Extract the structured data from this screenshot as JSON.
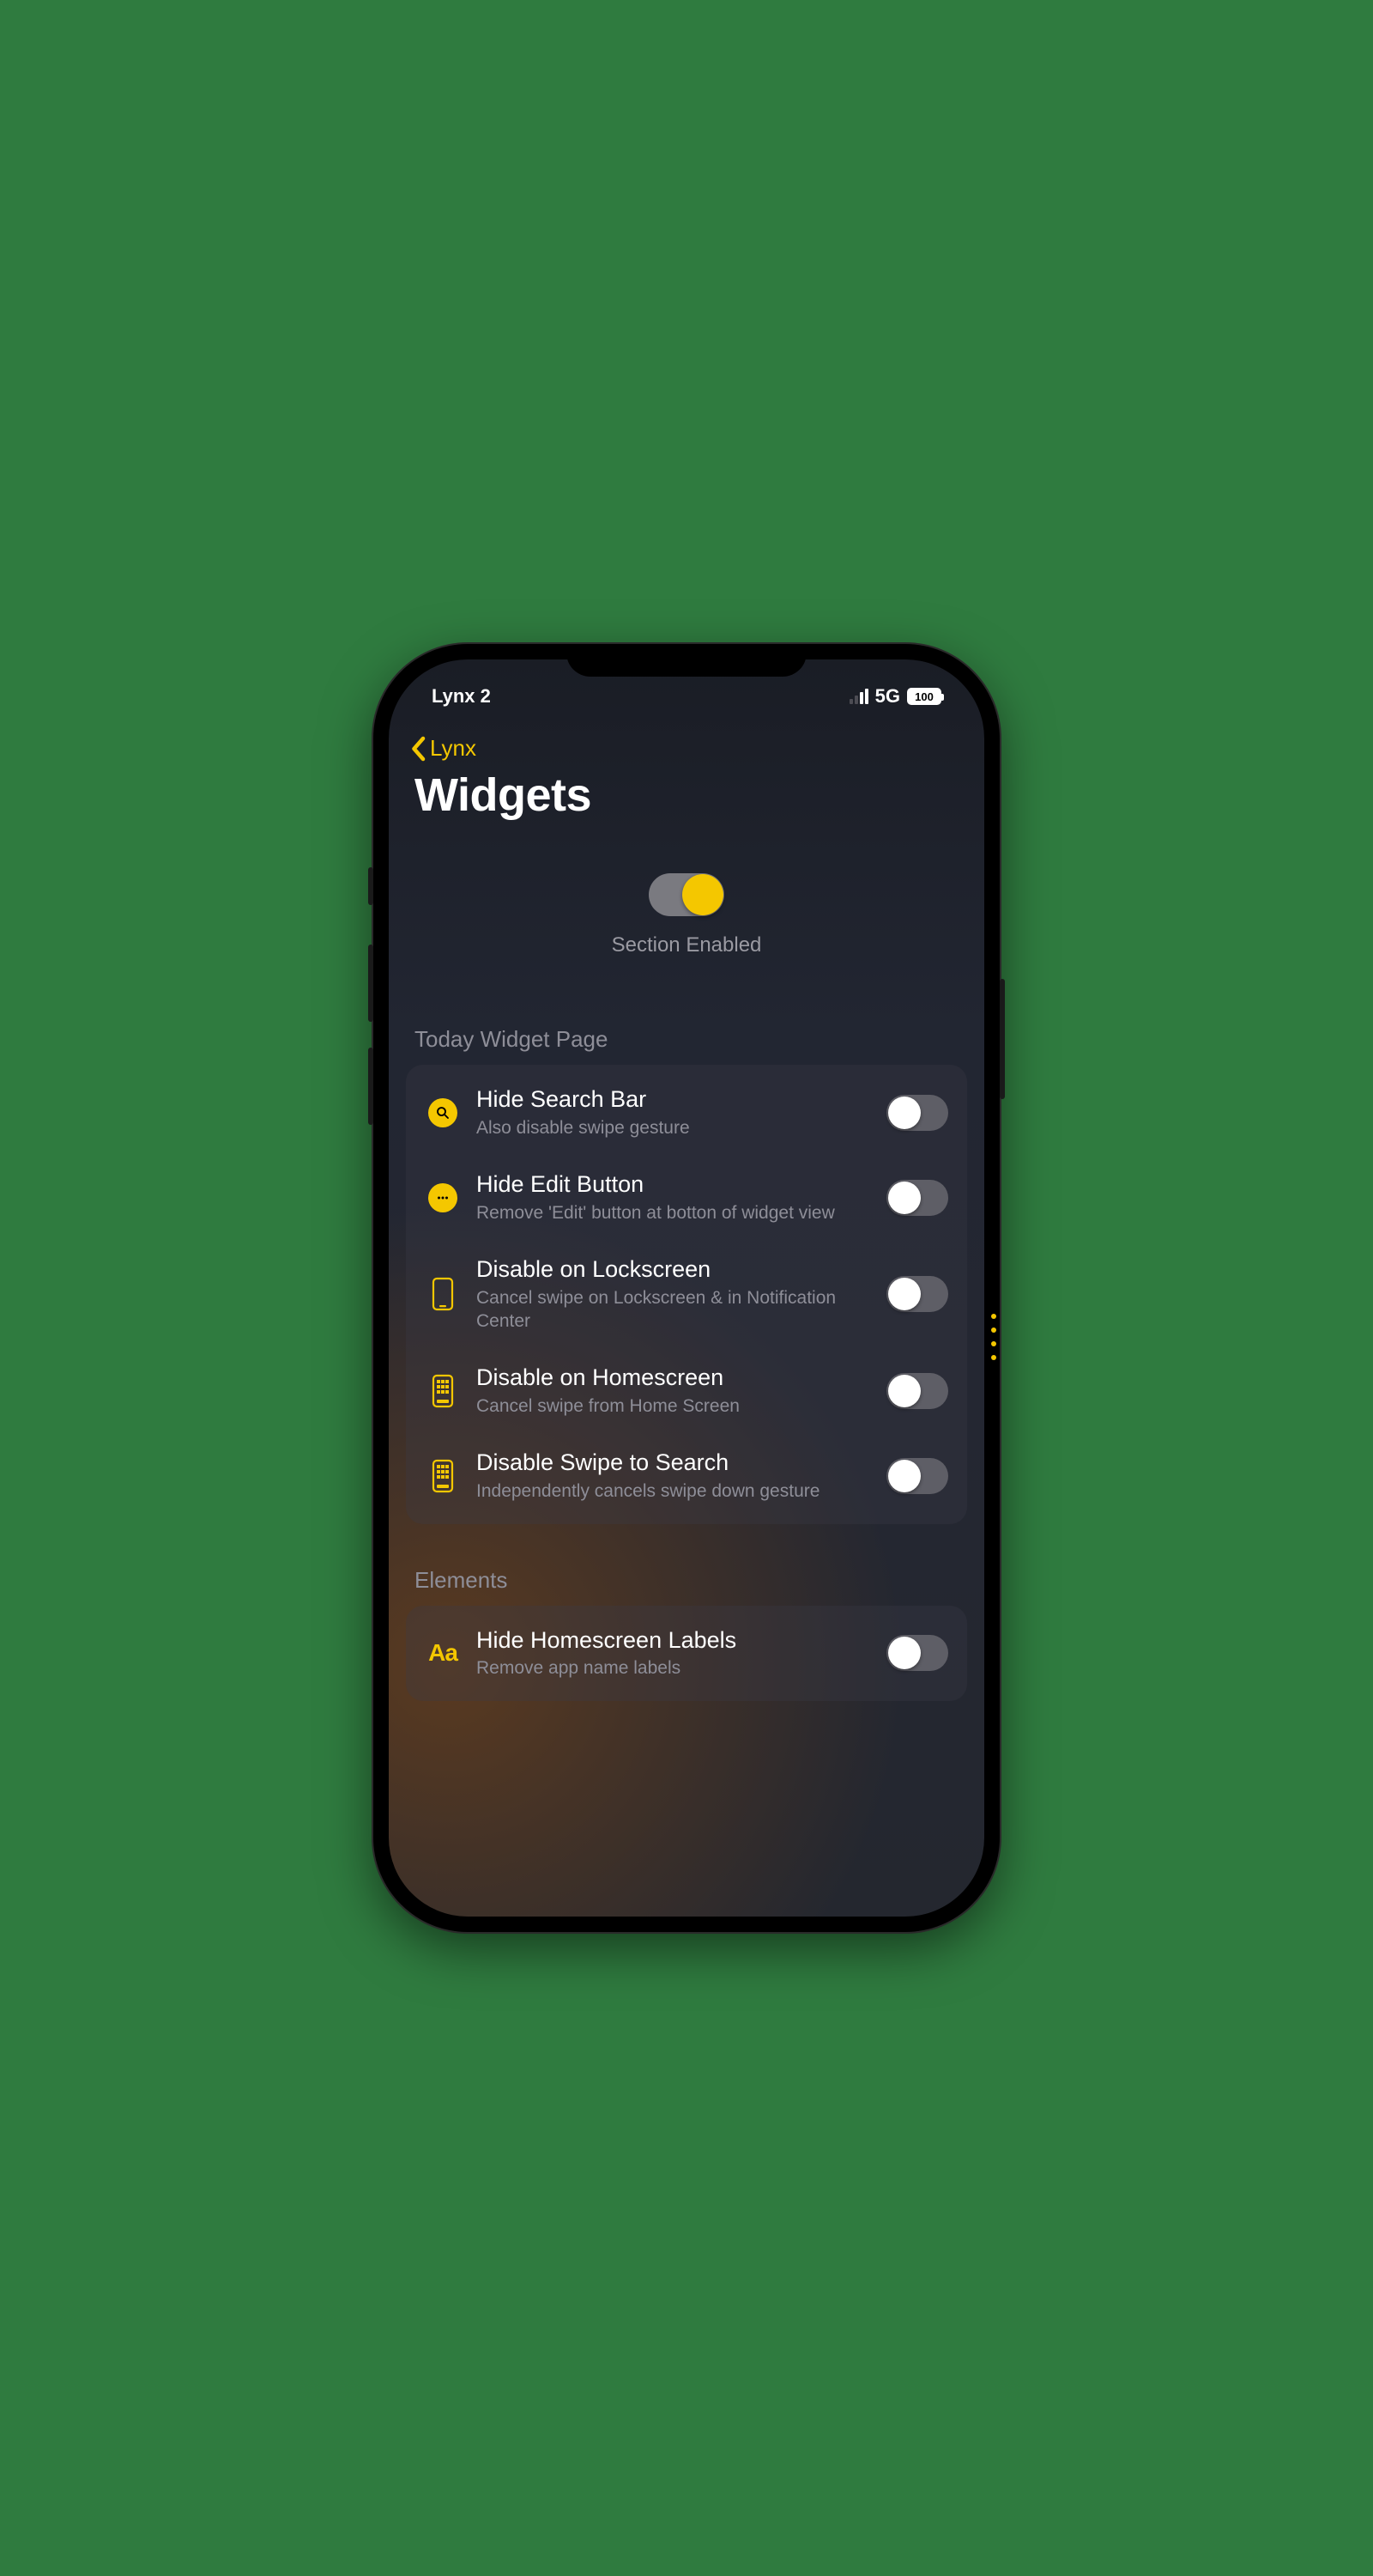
{
  "status": {
    "app_name": "Lynx 2",
    "network": "5G",
    "battery": "100"
  },
  "nav": {
    "back_label": "Lynx"
  },
  "page": {
    "title": "Widgets"
  },
  "hero": {
    "caption": "Section Enabled"
  },
  "groups": [
    {
      "header": "Today Widget Page",
      "rows": [
        {
          "title": "Hide Search Bar",
          "subtitle": "Also disable swipe gesture"
        },
        {
          "title": "Hide Edit Button",
          "subtitle": "Remove 'Edit' button at botton of widget view"
        },
        {
          "title": "Disable on Lockscreen",
          "subtitle": "Cancel swipe on Lockscreen & in Notification Center"
        },
        {
          "title": "Disable on Homescreen",
          "subtitle": "Cancel swipe from Home Screen"
        },
        {
          "title": "Disable Swipe to Search",
          "subtitle": "Independently cancels swipe down gesture"
        }
      ]
    },
    {
      "header": "Elements",
      "rows": [
        {
          "title": "Hide Homescreen Labels",
          "subtitle": "Remove app name labels"
        }
      ]
    }
  ],
  "colors": {
    "accent": "#f4c700"
  }
}
